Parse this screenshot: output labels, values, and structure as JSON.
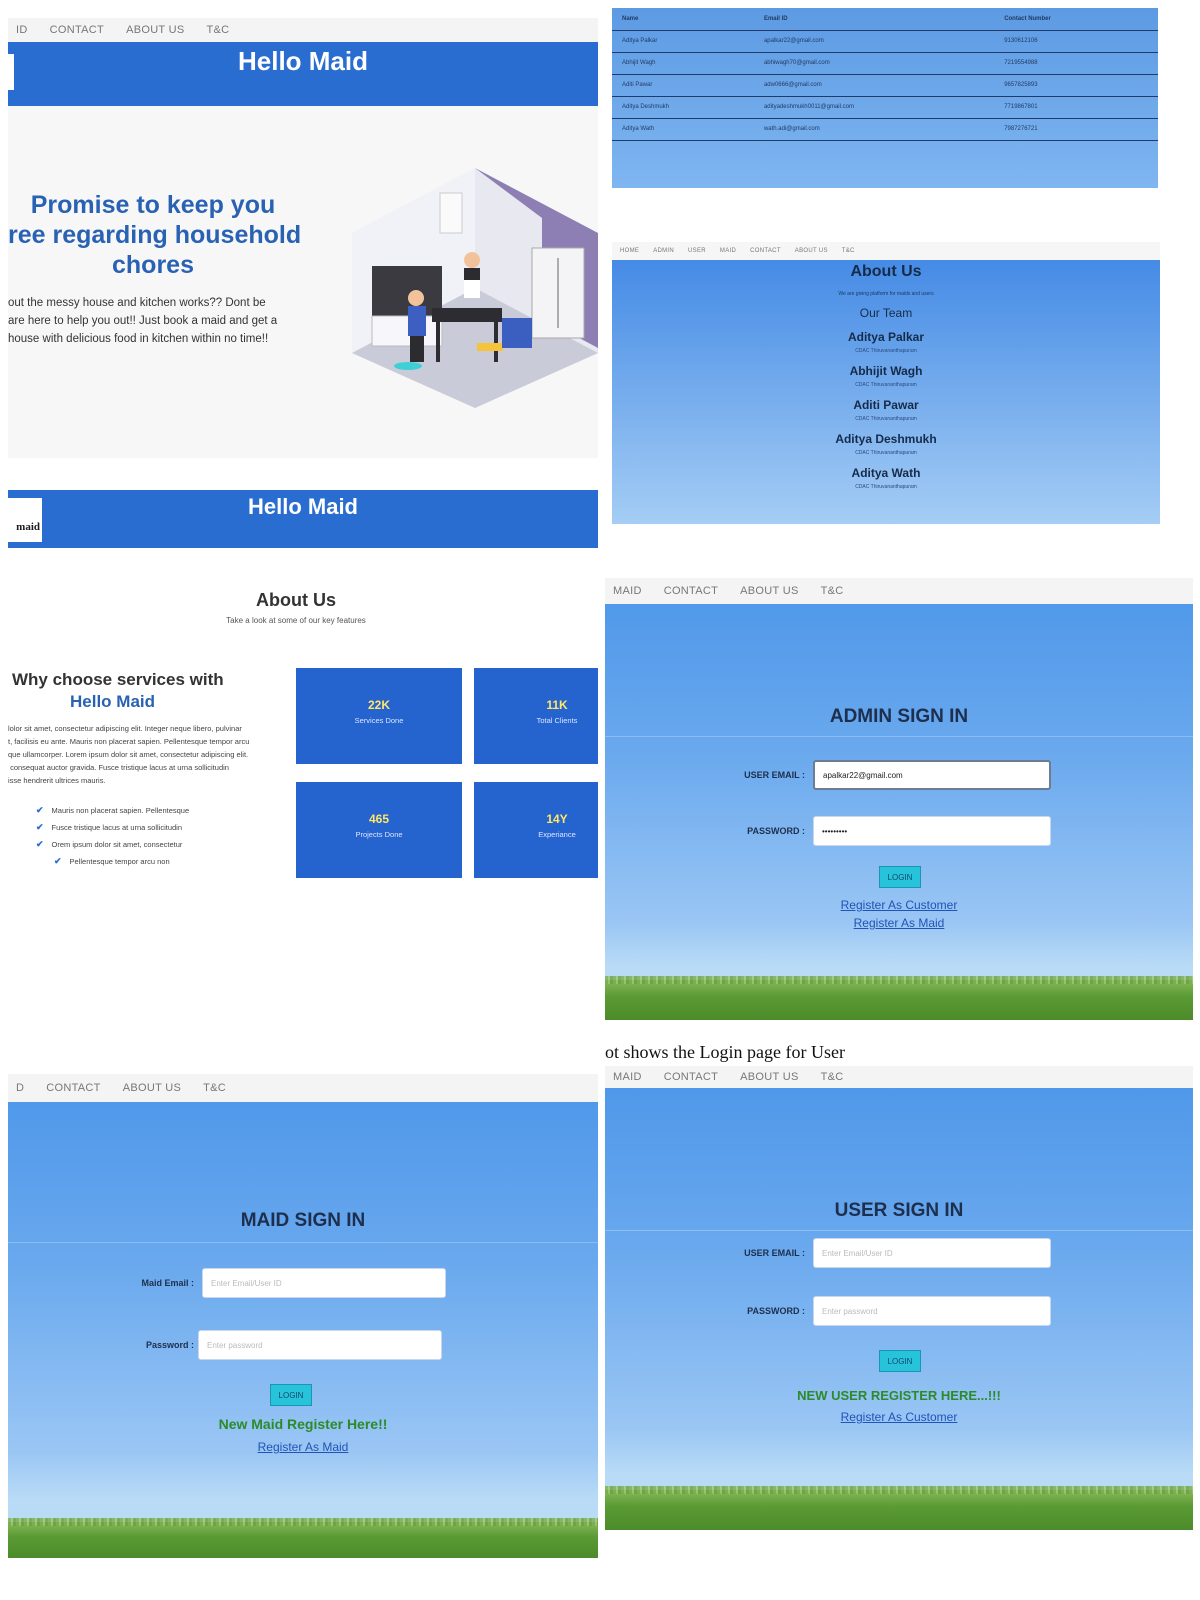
{
  "panel_home": {
    "nav": [
      "ID",
      "CONTACT",
      "ABOUT US",
      "T&C"
    ],
    "brand": "Hello Maid",
    "headline": "Promise to keep you\nree regarding household\nchores",
    "body": "out the messy house and kitchen works?? Dont be\nare here to help you out!! Just book a maid and get a\nhouse with delicious food in kitchen within no time!!"
  },
  "panel_table": {
    "headers": [
      "Name",
      "Email ID",
      "Contact Number"
    ],
    "rows": [
      [
        "Aditya Palkar",
        "apalkar22@gmail.com",
        "9130612106"
      ],
      [
        "Abhijit Wagh",
        "abhiwagh70@gmail.com",
        "7219554988"
      ],
      [
        "Aditi Pawar",
        "adw0666@gmail.com",
        "9657825893"
      ],
      [
        "Aditya Deshmukh",
        "adityadeshmukh0011@gmail.com",
        "7719867801"
      ],
      [
        "Aditya Wath",
        "wath.adi@gmail.com",
        "7987276721"
      ]
    ]
  },
  "panel_team": {
    "nav": [
      "HOME",
      "ADMIN",
      "USER",
      "MAID",
      "CONTACT",
      "ABOUT US",
      "T&C"
    ],
    "title": "About Us",
    "subtitle": "We are giving platform for maids and users",
    "section": "Our Team",
    "members": [
      {
        "name": "Aditya Palkar",
        "center": "CDAC Thiruvananthapuram"
      },
      {
        "name": "Abhijit Wagh",
        "center": "CDAC Thiruvananthapuram"
      },
      {
        "name": "Aditi Pawar",
        "center": "CDAC Thiruvananthapuram"
      },
      {
        "name": "Aditya Deshmukh",
        "center": "CDAC Thiruvananthapuram"
      },
      {
        "name": "Aditya Wath",
        "center": "CDAC Thiruvananthapuram"
      }
    ]
  },
  "panel_about": {
    "brand": "Hello Maid",
    "logo_text": "maid",
    "title": "About Us",
    "subtitle": "Take a look at some of our key features",
    "why_line1": "Why choose services with",
    "why_line2": "Hello Maid",
    "lorem": "lolor sit amet, consectetur adipiscing elit. Integer neque libero, pulvinar\nt, facilisis eu ante. Mauris non placerat sapien. Pellentesque tempor arcu\nque ullamcorper. Lorem ipsum dolor sit amet, consectetur adipiscing elit.\n consequat auctor gravida. Fusce tristique lacus at urna sollicitudin\nisse hendrerit ultrices mauris.",
    "checks": [
      "Mauris non placerat sapien. Pellentesque",
      "Fusce tristique lacus at urna sollicitudin",
      "Orem ipsum dolor sit amet, consectetur",
      "Pellentesque tempor arcu non"
    ],
    "stats": [
      {
        "value": "22K",
        "label": "Services Done"
      },
      {
        "value": "11K",
        "label": "Total Clients"
      },
      {
        "value": "465",
        "label": "Projects Done"
      },
      {
        "value": "14Y",
        "label": "Experiance"
      }
    ]
  },
  "panel_admin": {
    "nav": [
      "MAID",
      "CONTACT",
      "ABOUT US",
      "T&C"
    ],
    "title": "ADMIN SIGN IN",
    "email_label": "USER EMAIL :",
    "email_value": "apalkar22@gmail.com",
    "password_label": "PASSWORD :",
    "password_value": "•••••••••",
    "login": "LOGIN",
    "link_customer": "Register As Customer",
    "link_maid": "Register As Maid"
  },
  "panel_maid": {
    "nav": [
      "D",
      "CONTACT",
      "ABOUT US",
      "T&C"
    ],
    "title": "MAID SIGN IN",
    "email_label": "Maid Email :",
    "email_placeholder": "Enter Email/User ID",
    "password_label": "Password :",
    "password_placeholder": "Enter password",
    "login": "LOGIN",
    "register_prompt": "New Maid Register Here!!",
    "register_link": "Register As Maid"
  },
  "caption": "ot shows the Login page for User",
  "panel_user": {
    "nav": [
      "MAID",
      "CONTACT",
      "ABOUT US",
      "T&C"
    ],
    "title": "USER SIGN IN",
    "email_label": "USER EMAIL :",
    "email_placeholder": "Enter Email/User ID",
    "password_label": "PASSWORD :",
    "password_placeholder": "Enter password",
    "login": "LOGIN",
    "register_prompt": "NEW USER REGISTER HERE...!!!",
    "register_link": "Register As Customer"
  },
  "colors": {
    "brand_blue": "#2a6dd0",
    "accent_yellow": "#ffe766",
    "success_green": "#2d8a2b",
    "button_cyan": "#27c3db"
  }
}
